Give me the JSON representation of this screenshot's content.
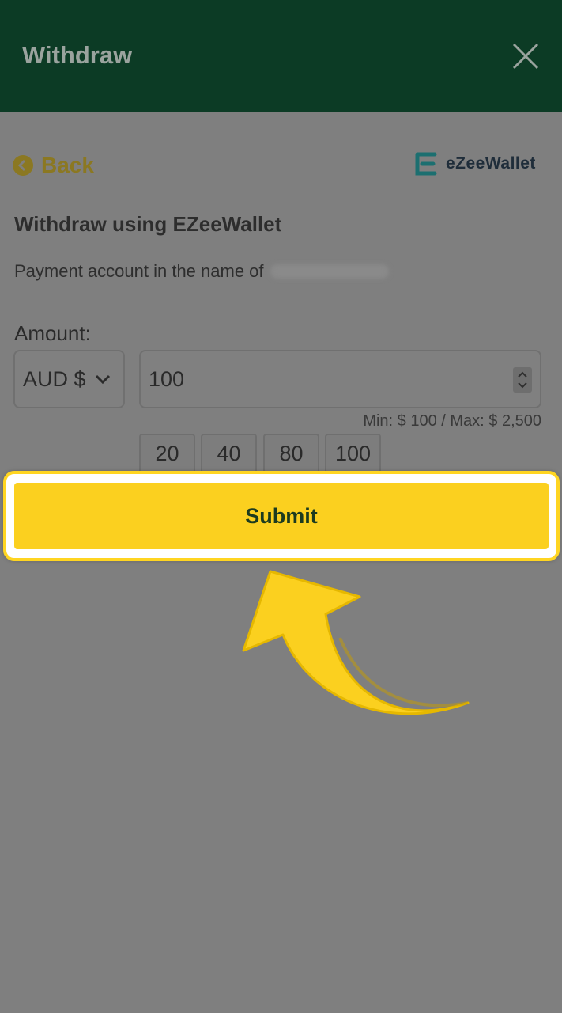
{
  "header": {
    "title": "Withdraw"
  },
  "nav": {
    "back_label": "Back"
  },
  "brand": {
    "name": "eZeeWallet",
    "color": "#1c8f8e"
  },
  "form": {
    "title": "Withdraw using EZeeWallet",
    "payment_prefix": "Payment account in the name of",
    "amount_label": "Amount:",
    "currency": "AUD $",
    "amount_value": "100",
    "limits": "Min: $ 100 / Max: $ 2,500",
    "presets": [
      "20",
      "40",
      "80",
      "100"
    ],
    "submit_label": "Submit"
  },
  "colors": {
    "header_bg": "#0c3b25",
    "accent_yellow": "#fbd01f",
    "overlay_gray": "#7f7f7f"
  }
}
